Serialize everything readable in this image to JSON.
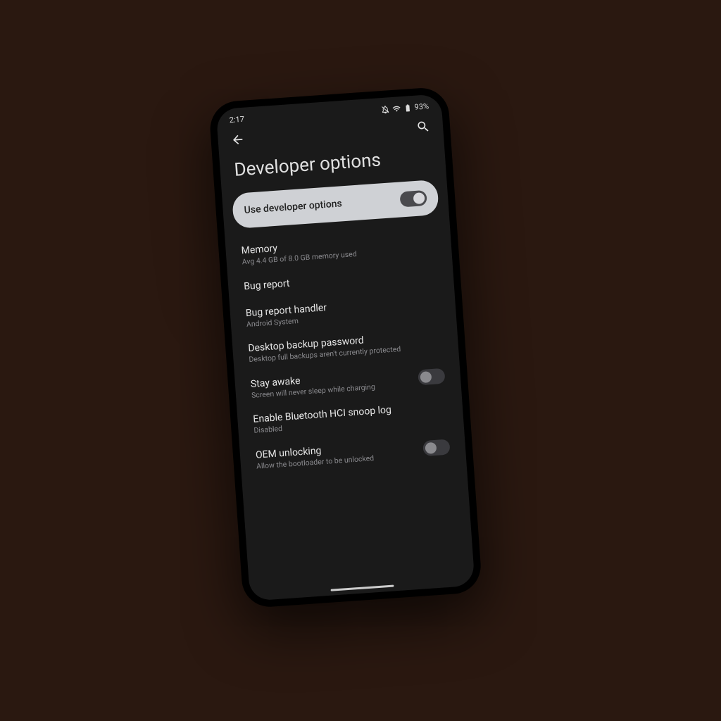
{
  "status": {
    "time": "2:17",
    "battery": "93%"
  },
  "page": {
    "title": "Developer options"
  },
  "master": {
    "label": "Use developer options",
    "on": true
  },
  "items": [
    {
      "title": "Memory",
      "subtitle": "Avg 4.4 GB of 8.0 GB memory used",
      "toggle": null
    },
    {
      "title": "Bug report",
      "subtitle": "",
      "toggle": null
    },
    {
      "title": "Bug report handler",
      "subtitle": "Android System",
      "toggle": null
    },
    {
      "title": "Desktop backup password",
      "subtitle": "Desktop full backups aren't currently protected",
      "toggle": null
    },
    {
      "title": "Stay awake",
      "subtitle": "Screen will never sleep while charging",
      "toggle": false
    },
    {
      "title": "Enable Bluetooth HCI snoop log",
      "subtitle": "Disabled",
      "toggle": null
    },
    {
      "title": "OEM unlocking",
      "subtitle": "Allow the bootloader to be unlocked",
      "toggle": false
    }
  ]
}
